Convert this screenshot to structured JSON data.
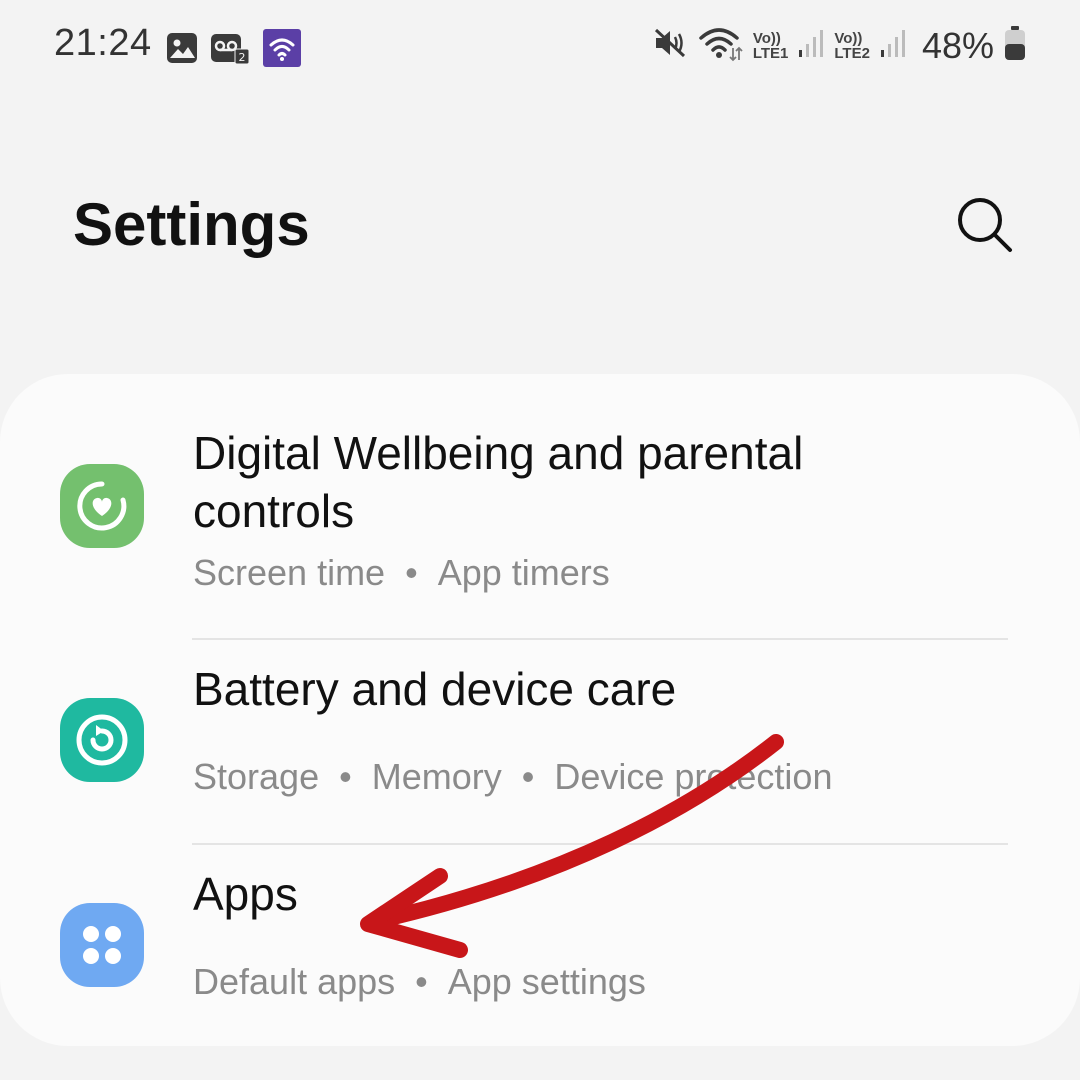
{
  "status_bar": {
    "time": "21:24",
    "battery": "48%",
    "sim1_tag": "Vo))",
    "sim1_label": "LTE1",
    "sim2_tag": "Vo))",
    "sim2_label": "LTE2",
    "left_icons": [
      "gallery-icon",
      "voicemail-icon",
      "wifi-calling-icon"
    ],
    "right_icons": [
      "mute-icon",
      "wifi-icon",
      "signal-icon",
      "battery-icon"
    ],
    "wifi_calling_color": "#5b3fa6"
  },
  "header": {
    "title": "Settings",
    "search_icon": "search-icon"
  },
  "settings_items": [
    {
      "title_line1": "Digital Wellbeing and parental",
      "title_line2": "controls",
      "sub1": "Screen time",
      "sub2": "App timers",
      "icon": "digital-wellbeing-icon",
      "icon_color": "#74c06e"
    },
    {
      "title_line1": "Battery and device care",
      "sub1": "Storage",
      "sub2": "Memory",
      "sub3": "Device protection",
      "icon": "device-care-icon",
      "icon_color": "#1fb9a0"
    },
    {
      "title_line1": "Apps",
      "sub1": "Default apps",
      "sub2": "App settings",
      "icon": "apps-icon",
      "icon_color": "#6fa9f2"
    }
  ],
  "separator": "•",
  "annotation": {
    "arrow_color": "#c81619"
  }
}
